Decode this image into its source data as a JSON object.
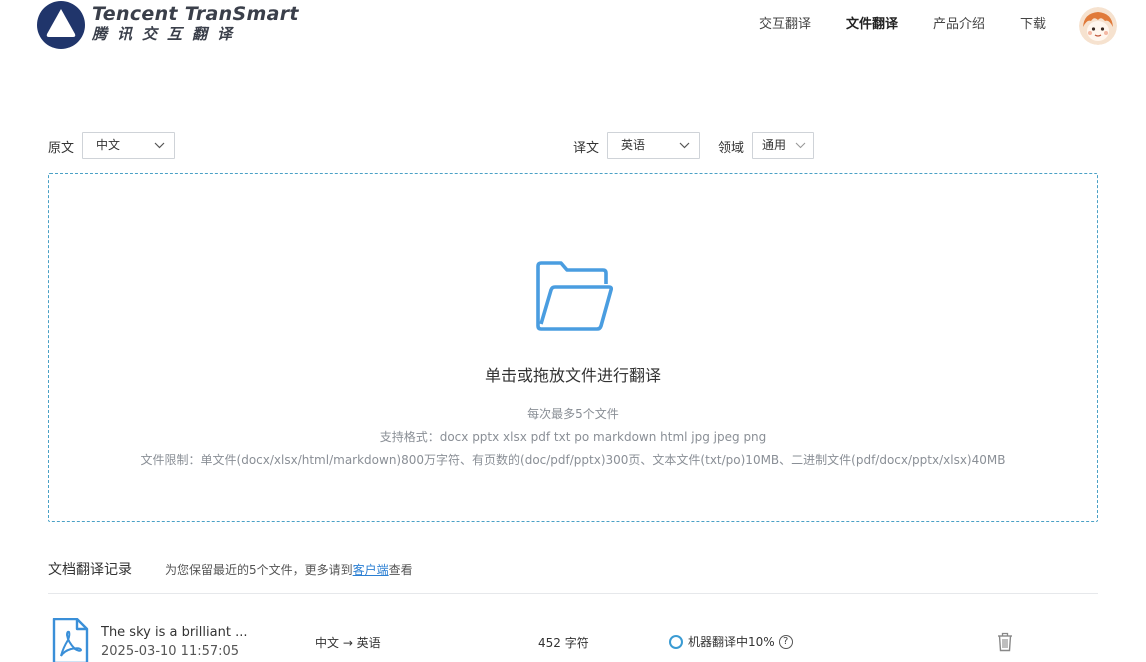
{
  "header": {
    "logo_en": "Tencent TranSmart",
    "logo_cn": "腾讯交互翻译",
    "nav": [
      {
        "label": "交互翻译",
        "active": false
      },
      {
        "label": "文件翻译",
        "active": true
      },
      {
        "label": "产品介绍",
        "active": false
      },
      {
        "label": "下载",
        "active": false
      }
    ]
  },
  "lang_bar": {
    "source_label": "原文",
    "source_value": "中文",
    "target_label": "译文",
    "target_value": "英语",
    "domain_label": "领域",
    "domain_value": "通用"
  },
  "dropzone": {
    "title": "单击或拖放文件进行翻译",
    "max_files": "每次最多5个文件",
    "formats": "支持格式：docx pptx xlsx pdf txt po markdown html jpg jpeg png",
    "limits": "文件限制：单文件(docx/xlsx/html/markdown)800万字符、有页数的(doc/pdf/pptx)300页、文本文件(txt/po)10MB、二进制文件(pdf/docx/pptx/xlsx)40MB"
  },
  "history": {
    "title": "文档翻译记录",
    "note_prefix": "为您保留最近的5个文件，更多请到",
    "note_link": "客户端",
    "note_suffix": "查看",
    "files": [
      {
        "name": "The sky is a brilliant ...",
        "date": "2025-03-10 11:57:05",
        "lang_pair": "中文 → 英语",
        "chars": "452 字符",
        "status": "机器翻译中10%",
        "progress": 0.1
      }
    ]
  },
  "colors": {
    "accent": "#2b7fd3",
    "dropzone_border": "#4aa1c6",
    "folder": "#4a9de0",
    "pdf": "#3a8fd8"
  }
}
